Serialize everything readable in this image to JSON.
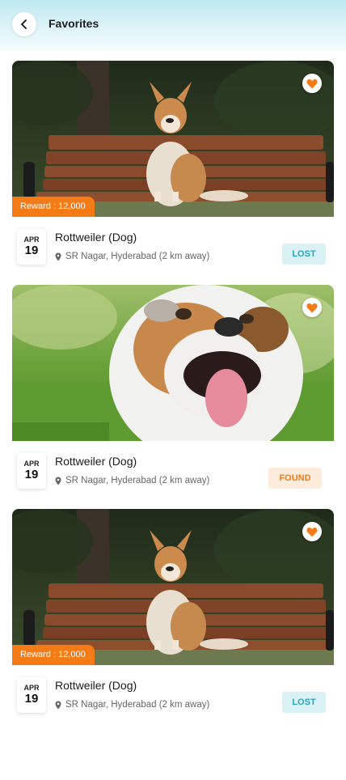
{
  "header": {
    "title": "Favorites"
  },
  "cards": [
    {
      "reward": "Reward : 12,000",
      "month": "APR",
      "day": "19",
      "name": "Rottweiler (Dog)",
      "location": "SR Nagar, Hyderabad (2 km away)",
      "status": "LOST"
    },
    {
      "reward": "",
      "month": "APR",
      "day": "19",
      "name": "Rottweiler (Dog)",
      "location": "SR Nagar, Hyderabad (2 km away)",
      "status": "FOUND"
    },
    {
      "reward": "Reward : 12,000",
      "month": "APR",
      "day": "19",
      "name": "Rottweiler (Dog)",
      "location": "SR Nagar, Hyderabad (2 km away)",
      "status": "LOST"
    }
  ],
  "icons": {
    "back": "chevron-left-icon",
    "favorite": "heart-icon",
    "location": "map-pin-icon"
  },
  "colors": {
    "accent": "#f47b15",
    "lost_bg": "#daf1f6",
    "lost_text": "#2aa4bd",
    "found_bg": "#fdecdc",
    "found_text": "#f07a17"
  }
}
